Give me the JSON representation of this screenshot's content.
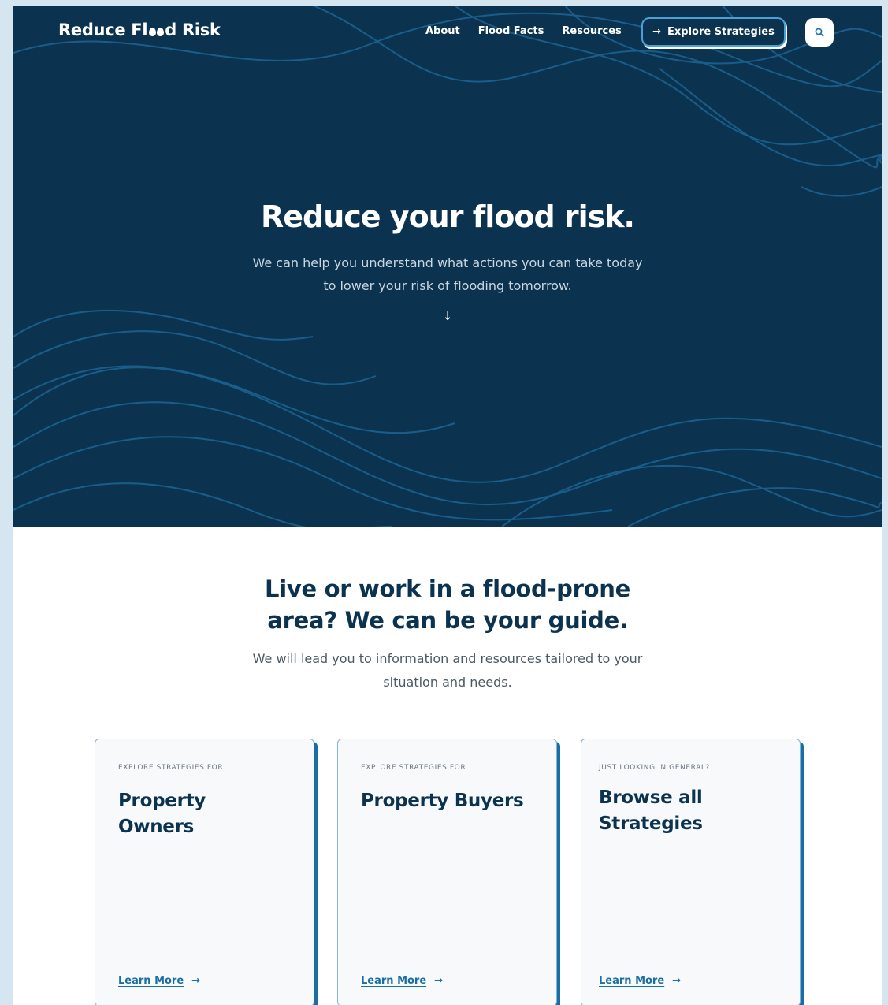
{
  "header": {
    "logo_part1": "Reduce Fl",
    "logo_part2": "d Risk",
    "nav": [
      "About",
      "Flood Facts",
      "Resources"
    ],
    "cta_label": "Explore Strategies",
    "search_icon": "search-icon"
  },
  "hero": {
    "title": "Reduce your flood risk.",
    "subtitle": "We can help you understand what actions you can take today to lower your risk of flooding tomorrow.",
    "arrow": "↓"
  },
  "guide": {
    "title": "Live or work in a flood-prone area? We can be your guide.",
    "subtitle": "We will lead you to information and resources tailored to your situation and needs."
  },
  "cards": [
    {
      "eyebrow": "Explore strategies for",
      "title": "Property Owners",
      "link": "Learn More"
    },
    {
      "eyebrow": "Explore strategies for",
      "title": "Property Buyers",
      "link": "Learn More"
    },
    {
      "eyebrow": "Just looking in general?",
      "title": "Browse all Strategies",
      "link": "Learn More"
    }
  ],
  "colors": {
    "navy": "#0b3350",
    "accent": "#1a6ea5",
    "wave": "#1d5f8c",
    "background": "#d6e6f0"
  }
}
